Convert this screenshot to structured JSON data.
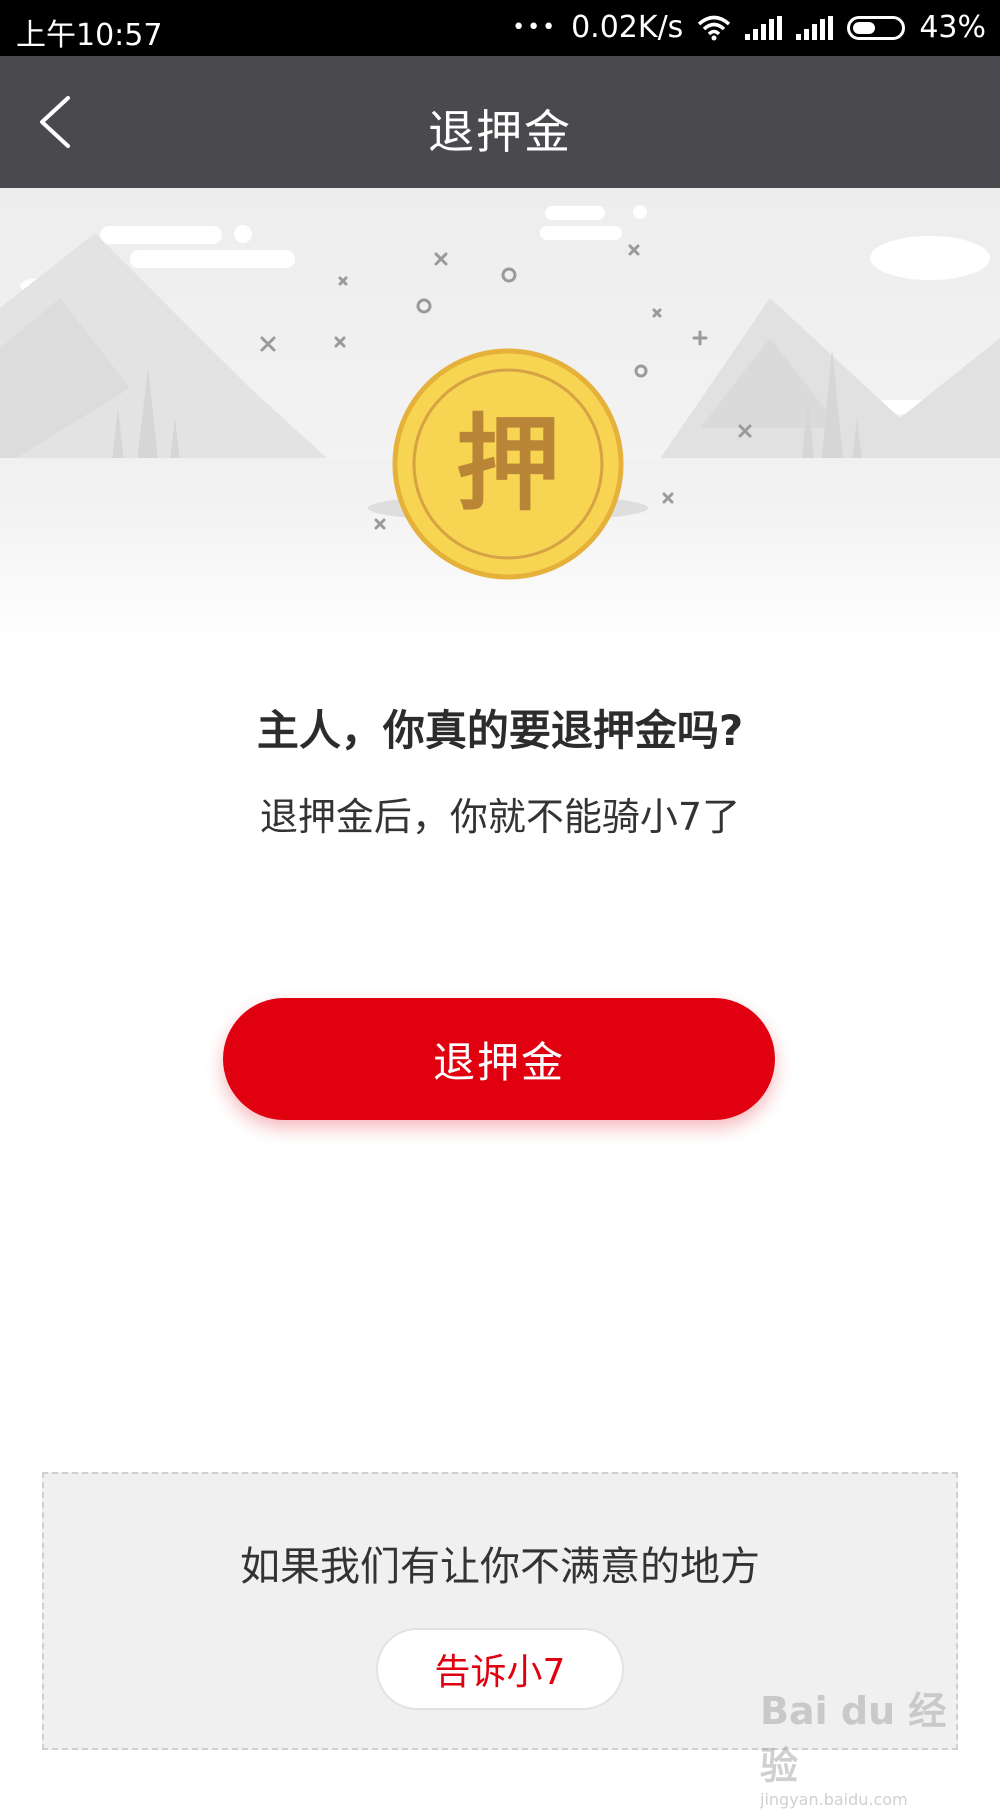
{
  "status_bar": {
    "time": "上午10:57",
    "dots": "•••",
    "speed": "0.02K/s",
    "battery": "43%"
  },
  "nav": {
    "title": "退押金"
  },
  "hero": {
    "coin_char": "押",
    "coin_color": "#f7d451"
  },
  "content": {
    "question": "主人，你真的要退押金吗?",
    "subtitle": "退押金后，你就不能骑小7了",
    "refund_button": "退押金"
  },
  "feedback": {
    "text": "如果我们有让你不满意的地方",
    "button": "告诉小7"
  },
  "watermark": {
    "brand": "Bai du 经验",
    "url": "jingyan.baidu.com"
  },
  "colors": {
    "accent": "#e00010",
    "navbar": "#4a494d"
  }
}
